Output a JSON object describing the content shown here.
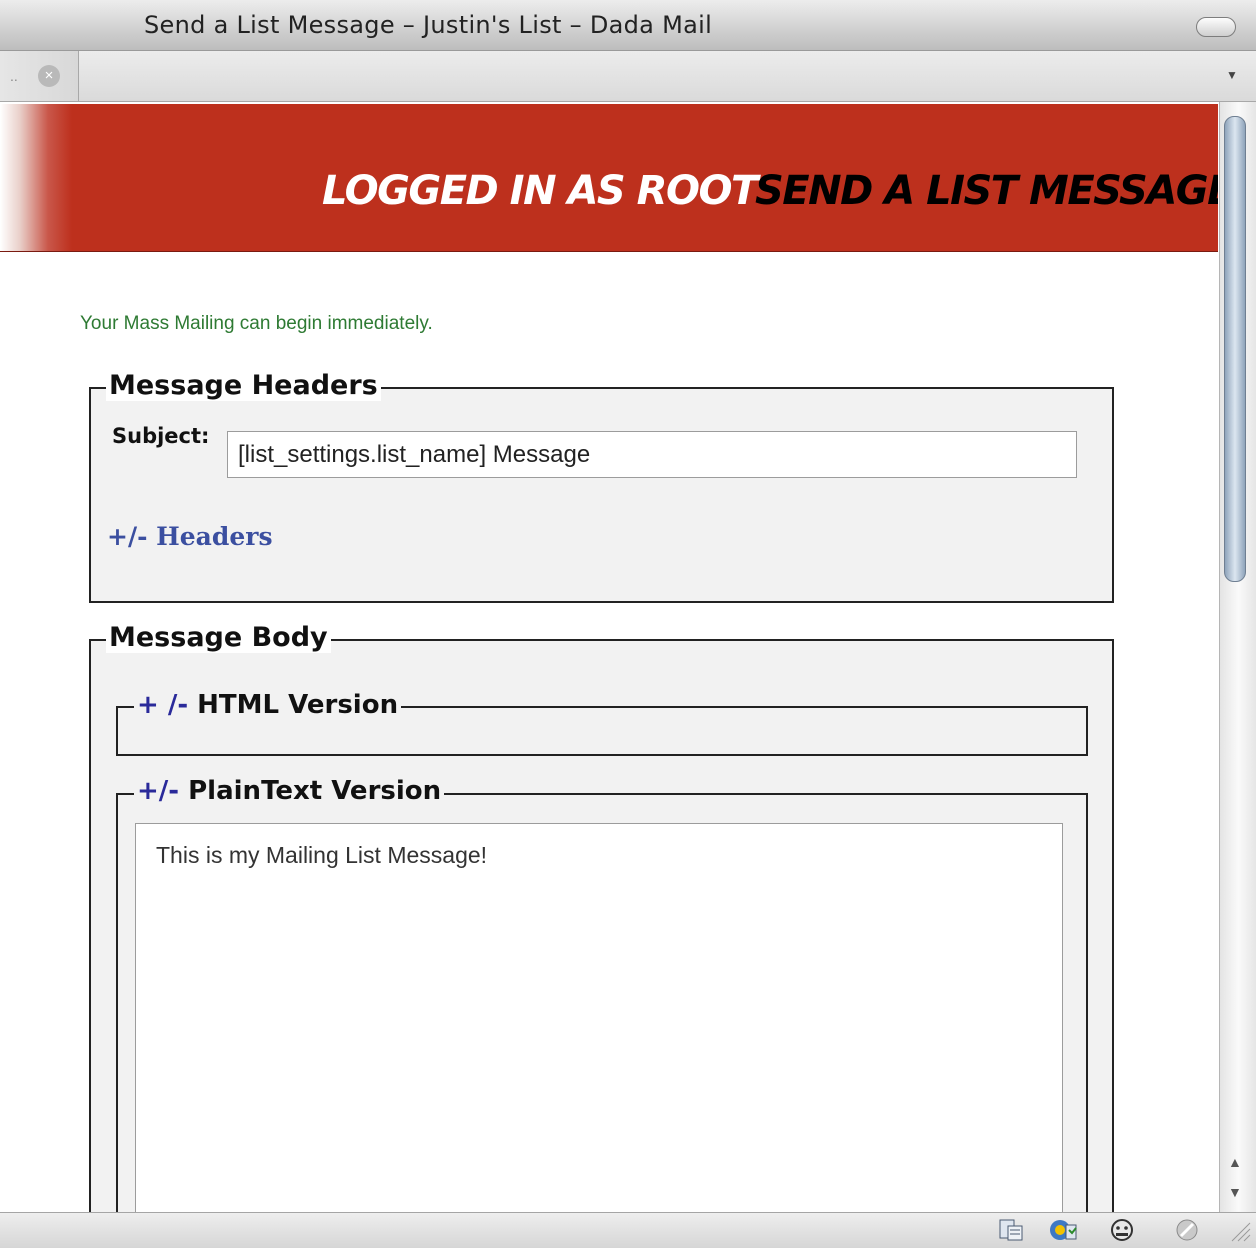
{
  "window": {
    "title": "Send a List Message – Justin's List – Dada Mail",
    "tab_dots": "..",
    "tab_close_glyph": "×",
    "tab_menu_glyph": "▼"
  },
  "banner": {
    "logged_in": "LOGGED IN AS ROOT",
    "screen_title": "SEND A LIST MESSAGE",
    "color": "#bd301d"
  },
  "notice": "Your Mass Mailing can begin immediately.",
  "headers_section": {
    "legend": "Message Headers",
    "subject_label": "Subject:",
    "subject_value": "[list_settings.list_name] Message",
    "toggle_link": "+/- Headers"
  },
  "body_section": {
    "legend": "Message Body",
    "html_toggle": "+ /-",
    "html_label": " HTML Version",
    "plain_toggle": "+/-",
    "plain_label": " PlainText Version",
    "plain_text": "This is my Mailing List Message!"
  },
  "scrollbar": {
    "up": "▲",
    "down": "▼"
  },
  "status_icons": [
    "page-icon",
    "sync-icon",
    "face-icon",
    "disabled-icon"
  ]
}
